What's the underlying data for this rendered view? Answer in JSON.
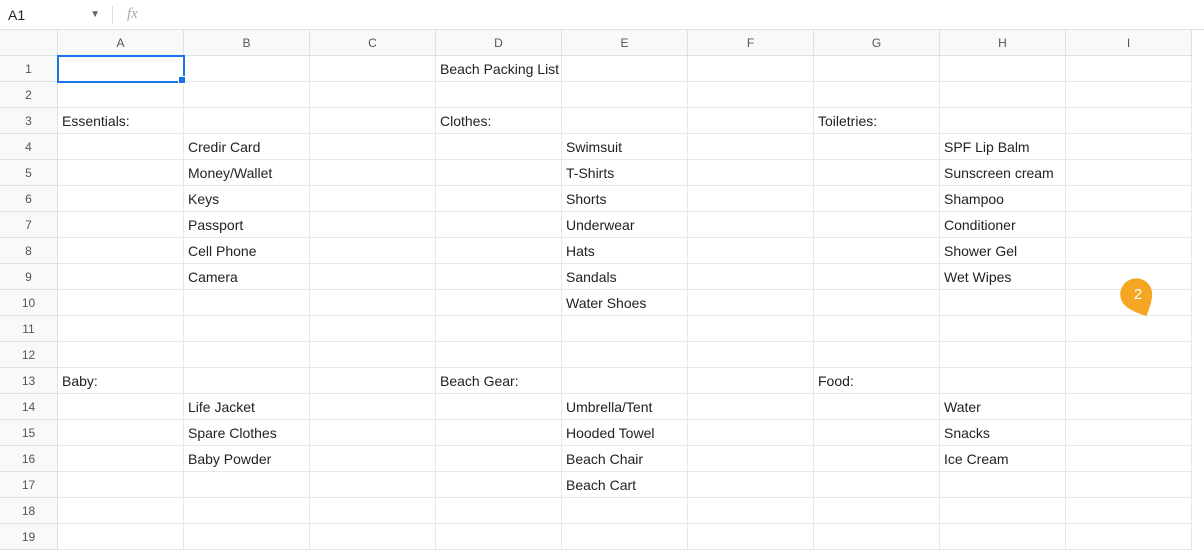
{
  "namebox": {
    "cellRef": "A1",
    "fxSymbol": "fx",
    "formula": ""
  },
  "columns": [
    "A",
    "B",
    "C",
    "D",
    "E",
    "F",
    "G",
    "H",
    "I"
  ],
  "rowCount": 19,
  "selectedCell": "A1",
  "cells": {
    "D1": "Beach Packing List",
    "A3": "Essentials:",
    "D3": "Clothes:",
    "G3": "Toiletries:",
    "B4": "Credir Card",
    "E4": "Swimsuit",
    "H4": "SPF Lip Balm",
    "B5": "Money/Wallet",
    "E5": "T-Shirts",
    "H5": "Sunscreen cream",
    "B6": "Keys",
    "E6": "Shorts",
    "H6": "Shampoo",
    "B7": "Passport",
    "E7": "Underwear",
    "H7": "Conditioner",
    "B8": "Cell Phone",
    "E8": "Hats",
    "H8": "Shower Gel",
    "B9": "Camera",
    "E9": "Sandals",
    "H9": "Wet Wipes",
    "E10": "Water Shoes",
    "A13": "Baby:",
    "D13": "Beach Gear:",
    "G13": "Food:",
    "B14": "Life Jacket",
    "E14": "Umbrella/Tent",
    "H14": "Water",
    "B15": "Spare Clothes",
    "E15": "Hooded Towel",
    "H15": "Snacks",
    "B16": "Baby Powder",
    "E16": "Beach Chair",
    "H16": "Ice Cream",
    "E17": "Beach Cart"
  },
  "marker": {
    "label": "2",
    "color": "#f5a623"
  }
}
